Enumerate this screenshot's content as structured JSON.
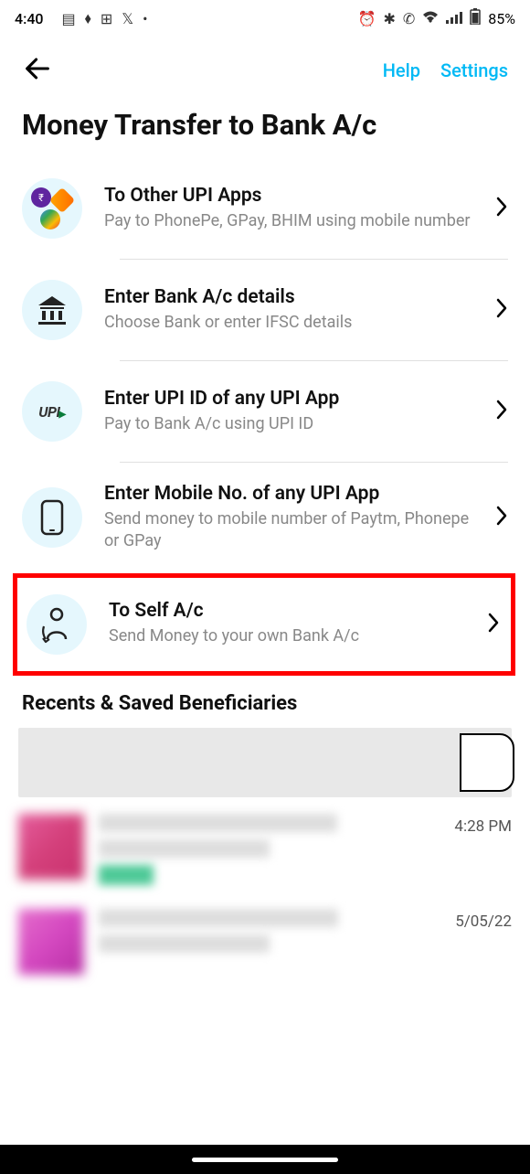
{
  "status": {
    "time": "4:40",
    "battery": "85%"
  },
  "header": {
    "help": "Help",
    "settings": "Settings"
  },
  "title": "Money Transfer to Bank A/c",
  "options": [
    {
      "title": "To Other UPI Apps",
      "subtitle": "Pay to PhonePe, GPay, BHIM using mobile number"
    },
    {
      "title": "Enter Bank A/c details",
      "subtitle": "Choose Bank or enter IFSC details"
    },
    {
      "title": "Enter UPI ID of any UPI App",
      "subtitle": "Pay to Bank A/c using UPI ID"
    },
    {
      "title": "Enter Mobile No. of any UPI App",
      "subtitle": "Send money to mobile number of Paytm, Phonepe or GPay"
    },
    {
      "title": "To Self A/c",
      "subtitle": "Send Money to your own Bank A/c"
    }
  ],
  "sectionTitle": "Recents & Saved Beneficiaries",
  "recents": [
    {
      "time": "4:28 PM"
    },
    {
      "time": "5/05/22"
    }
  ],
  "upiLabel": "UPI"
}
